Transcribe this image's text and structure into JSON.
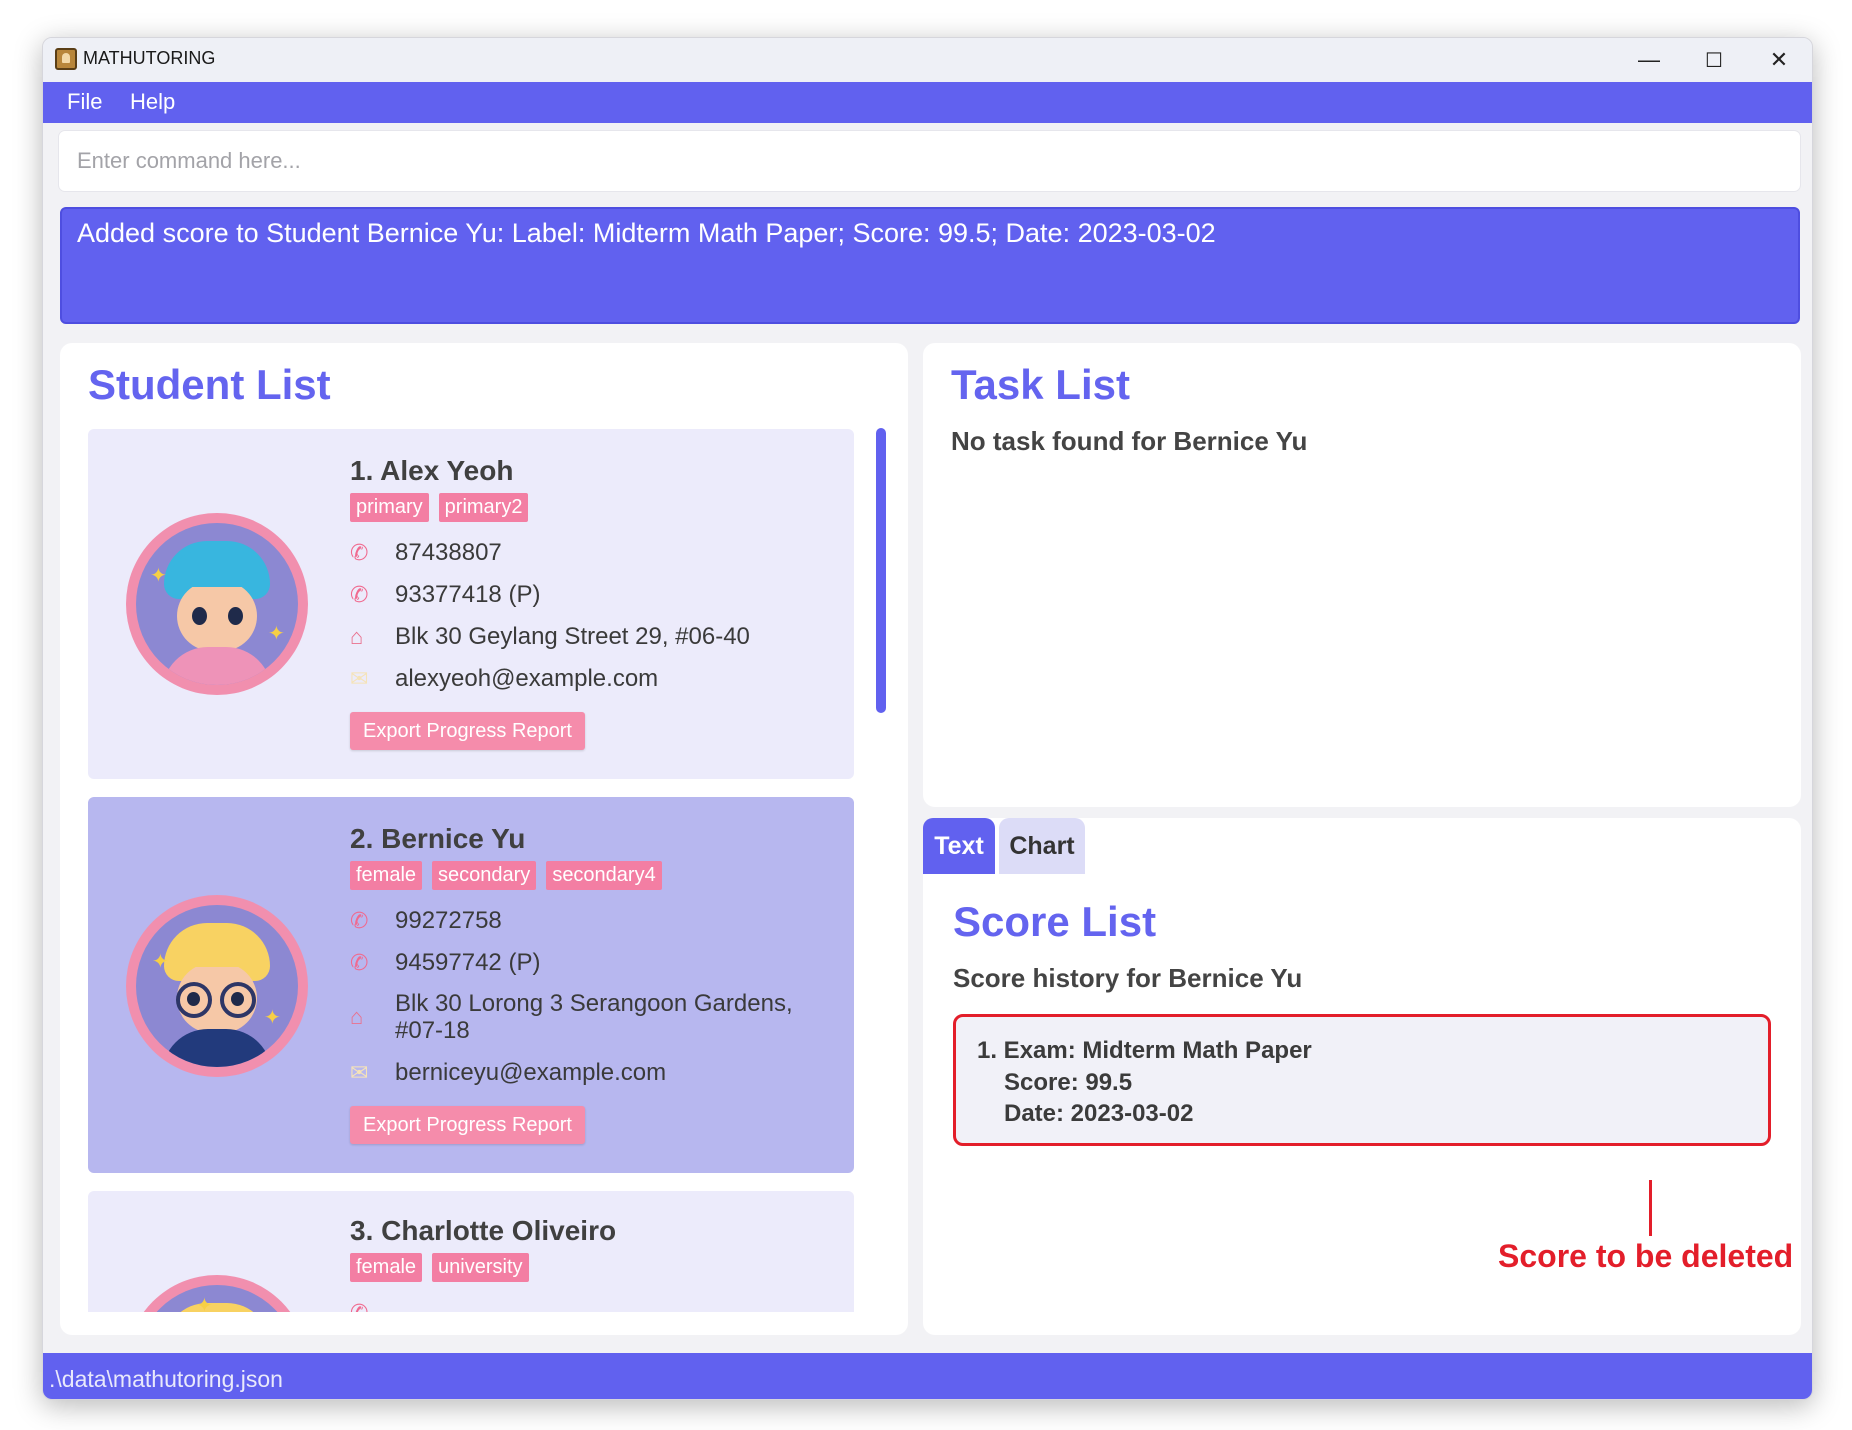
{
  "window": {
    "title": "MATHUTORING",
    "minimize": "—",
    "maximize": "☐",
    "close": "✕"
  },
  "menu": {
    "file": "File",
    "help": "Help"
  },
  "command": {
    "placeholder": "Enter command here...",
    "value": ""
  },
  "result": "Added score to Student Bernice Yu: Label: Midterm Math Paper; Score: 99.5; Date: 2023-03-02",
  "student_list": {
    "title": "Student List",
    "students": [
      {
        "name": "1.  Alex Yeoh",
        "tags": [
          "primary",
          "primary2"
        ],
        "phone": "87438807",
        "parent_phone": "93377418 (P)",
        "address": "Blk 30 Geylang Street 29, #06-40",
        "email": "alexyeoh@example.com",
        "export_label": "Export Progress Report"
      },
      {
        "name": "2.  Bernice Yu",
        "tags": [
          "female",
          "secondary",
          "secondary4"
        ],
        "phone": "99272758",
        "parent_phone": "94597742 (P)",
        "address_line1": "Blk 30 Lorong 3 Serangoon Gardens,",
        "address_line2": "#07-18",
        "email": "berniceyu@example.com",
        "export_label": "Export Progress Report",
        "selected": true
      },
      {
        "name": "3.  Charlotte Oliveiro",
        "tags": [
          "female",
          "university"
        ]
      }
    ]
  },
  "task_list": {
    "title": "Task List",
    "message": "No task found for Bernice Yu"
  },
  "score_panel": {
    "tabs": [
      "Text",
      "Chart"
    ],
    "active_tab": "Text",
    "title": "Score List",
    "subtitle": "Score history for Bernice Yu",
    "entries": [
      {
        "line1": "1. Exam: Midterm Math Paper",
        "line2": "Score: 99.5",
        "line3": "Date: 2023-03-02"
      }
    ]
  },
  "annotation": "Score to be deleted",
  "status_bar": ".\\data\\mathutoring.json",
  "colors": {
    "accent": "#6161ef",
    "tag": "#f37ea3",
    "callout": "#e31e2a"
  }
}
